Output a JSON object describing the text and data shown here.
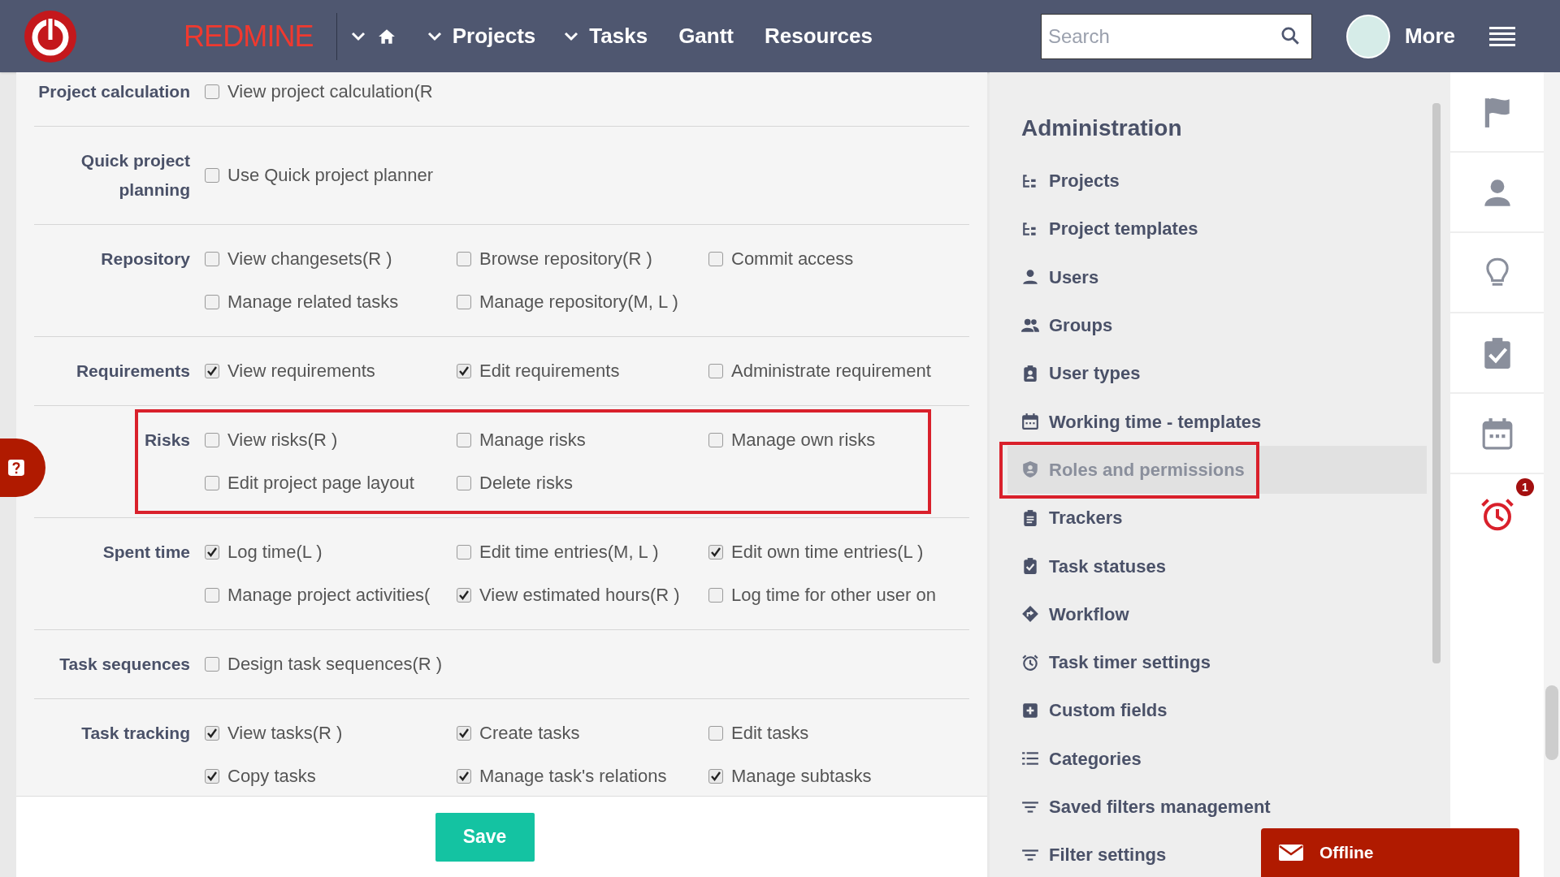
{
  "header": {
    "logo_text": "REDMINE",
    "nav": [
      {
        "label": "Projects"
      },
      {
        "label": "Tasks"
      },
      {
        "label": "Gantt"
      },
      {
        "label": "Resources"
      }
    ],
    "search": {
      "placeholder": "Search"
    },
    "more_label": "More"
  },
  "permission_sections": [
    {
      "label": "Project calculation",
      "highlighted": false,
      "permissions": [
        {
          "label": "View project calculation(R",
          "checked": false
        }
      ]
    },
    {
      "label": "Quick project planning",
      "highlighted": false,
      "permissions": [
        {
          "label": "Use Quick project planner",
          "checked": false
        }
      ]
    },
    {
      "label": "Repository",
      "highlighted": false,
      "permissions": [
        {
          "label": "View changesets(R )",
          "checked": false
        },
        {
          "label": "Browse repository(R )",
          "checked": false
        },
        {
          "label": "Commit access",
          "checked": false
        },
        {
          "label": "Manage related tasks",
          "checked": false
        },
        {
          "label": "Manage repository(M, L )",
          "checked": false
        }
      ]
    },
    {
      "label": "Requirements",
      "highlighted": false,
      "permissions": [
        {
          "label": "View requirements",
          "checked": true
        },
        {
          "label": "Edit requirements",
          "checked": true
        },
        {
          "label": "Administrate requirement",
          "checked": false
        }
      ]
    },
    {
      "label": "Risks",
      "highlighted": true,
      "permissions": [
        {
          "label": "View risks(R )",
          "checked": false
        },
        {
          "label": "Manage risks",
          "checked": false
        },
        {
          "label": "Manage own risks",
          "checked": false
        },
        {
          "label": "Edit project page layout",
          "checked": false
        },
        {
          "label": "Delete risks",
          "checked": false
        }
      ]
    },
    {
      "label": "Spent time",
      "highlighted": false,
      "permissions": [
        {
          "label": "Log time(L )",
          "checked": true
        },
        {
          "label": "Edit time entries(M, L )",
          "checked": false
        },
        {
          "label": "Edit own time entries(L )",
          "checked": true
        },
        {
          "label": "Manage project activities(",
          "checked": false
        },
        {
          "label": "View estimated hours(R )",
          "checked": true
        },
        {
          "label": "Log time for other user on",
          "checked": false
        }
      ]
    },
    {
      "label": "Task sequences",
      "highlighted": false,
      "permissions": [
        {
          "label": "Design task sequences(R )",
          "checked": false
        }
      ]
    },
    {
      "label": "Task tracking",
      "highlighted": false,
      "permissions": [
        {
          "label": "View tasks(R )",
          "checked": true
        },
        {
          "label": "Create tasks",
          "checked": true
        },
        {
          "label": "Edit tasks",
          "checked": false
        },
        {
          "label": "Copy tasks",
          "checked": true
        },
        {
          "label": "Manage task's relations",
          "checked": true
        },
        {
          "label": "Manage subtasks",
          "checked": true
        }
      ]
    }
  ],
  "save_button": "Save",
  "sidebar": {
    "title": "Administration",
    "items": [
      {
        "label": "Projects",
        "selected": false,
        "highlighted": false
      },
      {
        "label": "Project templates",
        "selected": false,
        "highlighted": false
      },
      {
        "label": "Users",
        "selected": false,
        "highlighted": false
      },
      {
        "label": "Groups",
        "selected": false,
        "highlighted": false
      },
      {
        "label": "User types",
        "selected": false,
        "highlighted": false
      },
      {
        "label": "Working time - templates",
        "selected": false,
        "highlighted": false
      },
      {
        "label": "Roles and permissions",
        "selected": true,
        "highlighted": true
      },
      {
        "label": "Trackers",
        "selected": false,
        "highlighted": false
      },
      {
        "label": "Task statuses",
        "selected": false,
        "highlighted": false
      },
      {
        "label": "Workflow",
        "selected": false,
        "highlighted": false
      },
      {
        "label": "Task timer settings",
        "selected": false,
        "highlighted": false
      },
      {
        "label": "Custom fields",
        "selected": false,
        "highlighted": false
      },
      {
        "label": "Categories",
        "selected": false,
        "highlighted": false
      },
      {
        "label": "Saved filters management",
        "selected": false,
        "highlighted": false
      },
      {
        "label": "Filter settings",
        "selected": false,
        "highlighted": false
      }
    ]
  },
  "rail": {
    "alarm_badge": "1"
  },
  "chat_button": "Offline"
}
